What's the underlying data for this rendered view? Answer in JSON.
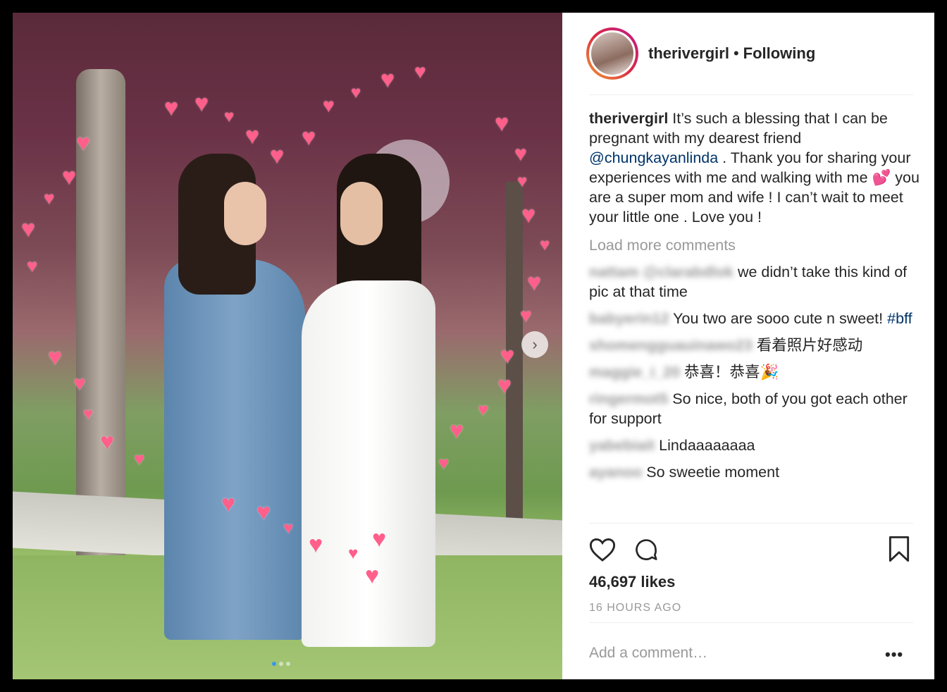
{
  "post": {
    "username": "therivergirl",
    "separator": "•",
    "follow_status": "Following",
    "caption": {
      "username": "therivergirl",
      "text_1": " It’s such a blessing that I can be pregnant with my dearest friend ",
      "mention": "@chungkayanlinda",
      "text_2": " . Thank you for sharing your experiences with me and walking with me 💕  you are a super mom and wife ! I can’t wait to meet your little one . Love you !"
    },
    "load_more": "Load more comments",
    "comments": [
      {
        "user": "nattam @clarabdlok",
        "text": " we didn’t take this kind of pic at that time",
        "tag": ""
      },
      {
        "user": "babyerin12",
        "text": " You two are sooo cute n sweet! ",
        "tag": "#bff"
      },
      {
        "user": "shomengguauinawo23",
        "text": " 看着照片好感动",
        "tag": ""
      },
      {
        "user": "maggie_i_20",
        "text": " 恭喜！恭喜🎉",
        "tag": ""
      },
      {
        "user": "ringermot5",
        "text": " So nice, both of you got each other for support",
        "tag": ""
      },
      {
        "user": "yabebiait",
        "text": " Lindaaaaaaaa",
        "tag": ""
      },
      {
        "user": "ayanoo",
        "text": " So sweetie moment",
        "tag": ""
      }
    ],
    "likes": "46,697 likes",
    "time": "16 HOURS AGO",
    "add_comment_placeholder": "Add a comment…",
    "more_options": "•••"
  },
  "icons": {
    "like": "heart-outline-icon",
    "comment": "speech-bubble-icon",
    "save": "bookmark-icon",
    "carousel": "chevron-right-icon"
  },
  "colors": {
    "link": "#003569",
    "muted": "#999999",
    "text": "#262626"
  }
}
